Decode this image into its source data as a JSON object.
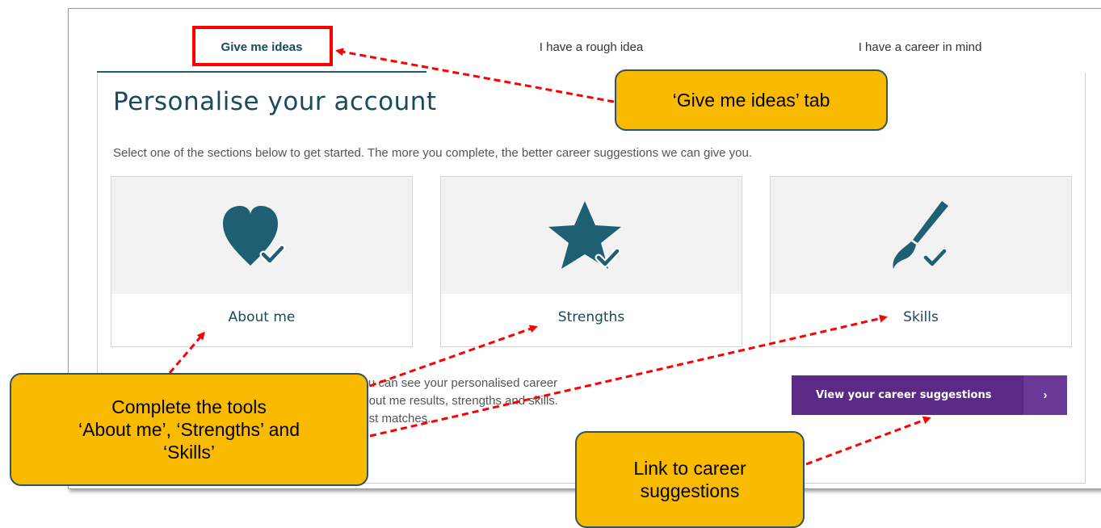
{
  "tabs": [
    {
      "label": "Give me ideas",
      "active": true
    },
    {
      "label": "I have a rough idea",
      "active": false
    },
    {
      "label": "I have a career in mind",
      "active": false
    }
  ],
  "page": {
    "title": "Personalise your account",
    "intro": "Select one of the sections below to get started. The more you complete, the better career suggestions we can give you."
  },
  "cards": [
    {
      "label": "About me",
      "icon": "heart-check-icon"
    },
    {
      "label": "Strengths",
      "icon": "star-check-icon"
    },
    {
      "label": "Skills",
      "icon": "paintbrush-check-icon"
    }
  ],
  "body_text": {
    "line1": "you can see your personalised career",
    "line2": "about me results, strengths and skills.",
    "line3": "best matches."
  },
  "cta": {
    "label": "View your career suggestions",
    "arrow": "›"
  },
  "callouts": {
    "tab": "‘Give me ideas’ tab",
    "tools_line1": "Complete the tools",
    "tools_line2": "‘About me’, ‘Strengths’ and",
    "tools_line3": "‘Skills’",
    "link_line1": "Link to career",
    "link_line2": "suggestions"
  },
  "colors": {
    "accent": "#1b4a5a",
    "icon": "#1f5f74",
    "cta": "#5b2a86",
    "callout": "#f9bb00",
    "annotation": "#ff0000"
  }
}
